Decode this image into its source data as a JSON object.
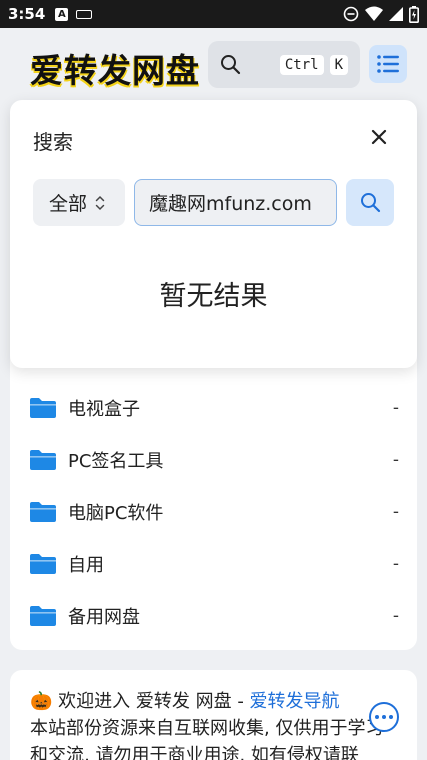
{
  "status_bar": {
    "time": "3:54",
    "notification_icon": "A",
    "icons": [
      "keyboard-icon",
      "dnd-icon",
      "wifi-icon",
      "signal-icon",
      "battery-icon"
    ]
  },
  "header": {
    "logo": "爱转发网盘",
    "search_key1": "Ctrl",
    "search_key2": "K",
    "accent_color": "#1e6fd9"
  },
  "search_modal": {
    "title": "搜索",
    "scope_value": "全部",
    "query": "魔趣网mfunz.com",
    "empty_message": "暂无结果"
  },
  "folders": [
    {
      "name": "电视盒子",
      "size": "-"
    },
    {
      "name": "PC签名工具",
      "size": "-"
    },
    {
      "name": "电脑PC软件",
      "size": "-"
    },
    {
      "name": "自用",
      "size": "-"
    },
    {
      "name": "备用网盘",
      "size": "-"
    }
  ],
  "info": {
    "emoji": "🎃",
    "welcome": "欢迎进入 爱转发 网盘 - ",
    "nav_link": "爱转发导航",
    "body": "本站部份资源来自互联网收集, 仅供用于学习和交流, 请勿用于商业用途. 如有侵权请联"
  }
}
